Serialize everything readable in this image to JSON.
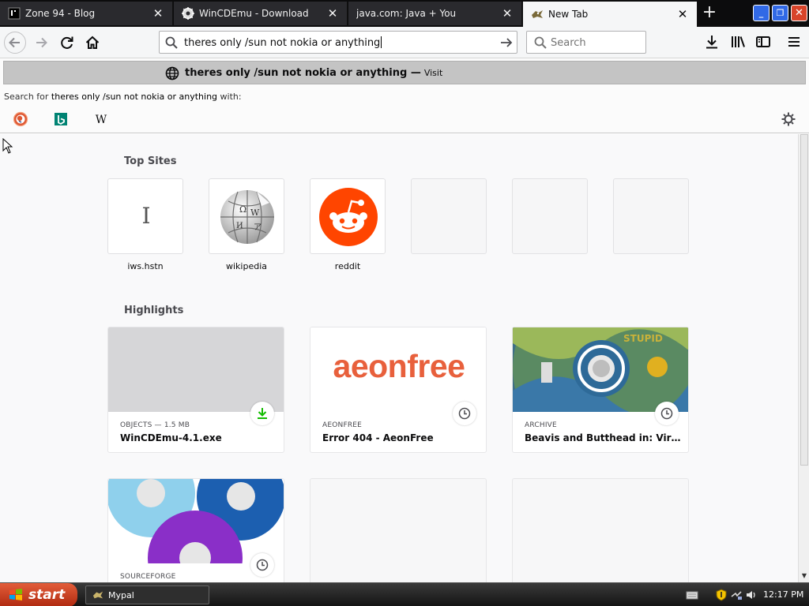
{
  "tabs": [
    {
      "title": "Zone 94 - Blog",
      "icon": "zone94-favicon",
      "close": "✕"
    },
    {
      "title": "WinCDEmu - Download",
      "icon": "wincdemu-favicon",
      "close": "✕"
    },
    {
      "title": "java.com: Java + You",
      "icon": "blank-favicon",
      "close": "✕"
    },
    {
      "title": "New Tab",
      "icon": "mypal-favicon",
      "close": "✕",
      "active": true
    }
  ],
  "new_tab_symbol": "+",
  "window_controls": {
    "minimize": "_",
    "maximize": "❐",
    "close": "✕"
  },
  "urlbar": {
    "value": "theres only /sun not nokia or anything"
  },
  "searchbar": {
    "placeholder": "Search"
  },
  "dropdown": {
    "result_title": "theres only /sun not nokia or anything",
    "result_separator": "—",
    "result_action": "Visit",
    "search_for_prefix": "Search for",
    "search_for_query": "theres only /sun not nokia or anything",
    "search_for_suffix": "with:",
    "engines": [
      "duckduckgo-icon",
      "bing-icon",
      "wikipedia-icon"
    ]
  },
  "top_sites": {
    "heading": "Top Sites",
    "items": [
      {
        "label": "iws.hstn",
        "glyph": "I"
      },
      {
        "label": "wikipedia"
      },
      {
        "label": "reddit"
      },
      {
        "label": ""
      },
      {
        "label": ""
      },
      {
        "label": ""
      }
    ]
  },
  "highlights": {
    "heading": "Highlights",
    "cards": [
      {
        "context": "OBJECTS — 1.5 MB",
        "title": "WinCDEmu-4.1.exe",
        "badge": "download-icon"
      },
      {
        "context": "AEONFREE",
        "title": "Error 404 - AeonFree",
        "badge": "clock-icon",
        "thumb_text": "aeonfree"
      },
      {
        "context": "ARCHIVE",
        "title": "Beavis and Butthead in: Virtual S...",
        "badge": "clock-icon"
      },
      {
        "context": "SOURCEFORGE",
        "title": "",
        "badge": "clock-icon"
      }
    ]
  },
  "taskbar": {
    "start_label": "start",
    "task_label": "Mypal",
    "clock": "12:17 PM"
  },
  "colors": {
    "tab_strip": "#0c0c0d",
    "active_tab": "#f5f6f7",
    "reddit_orange": "#ff4500",
    "aeonfree_orange": "#e8603c",
    "download_green": "#12bc00"
  }
}
